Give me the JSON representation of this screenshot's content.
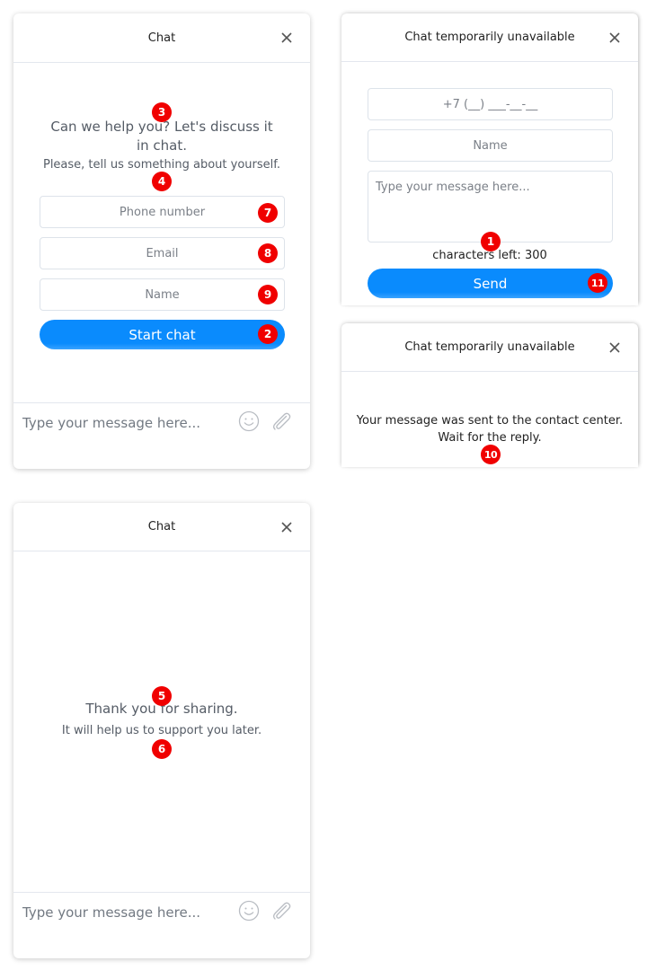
{
  "panel_start": {
    "title": "Chat",
    "heading": "Can we help you? Let's discuss it in chat.",
    "subheading": "Please, tell us something about yourself.",
    "fields": [
      {
        "placeholder": "Phone number",
        "badge": "7"
      },
      {
        "placeholder": "Email",
        "badge": "8"
      },
      {
        "placeholder": "Name",
        "badge": "9"
      }
    ],
    "start_button": "Start chat",
    "start_badge": "2",
    "heading_badge": "3",
    "subheading_badge": "4",
    "message_placeholder": "Type your message here..."
  },
  "panel_offline_form": {
    "title": "Chat temporarily unavailable",
    "phone_mask": "+7 (__) ___-__-__",
    "name_placeholder": "Name",
    "message_placeholder": "Type your message here...",
    "chars_left": "characters left: 300",
    "chars_badge": "1",
    "send_button": "Send",
    "send_badge": "11"
  },
  "panel_offline_sent": {
    "title": "Chat temporarily unavailable",
    "message": "Your message was sent to the contact center. Wait for the reply.",
    "message_badge": "10"
  },
  "panel_thanks": {
    "title": "Chat",
    "heading": "Thank you for sharing.",
    "subheading": "It will help us to support you later.",
    "heading_badge": "5",
    "subheading_badge": "6",
    "message_placeholder": "Type your message here..."
  },
  "icons": {
    "close": "close-icon",
    "emoji": "smiley-icon",
    "attach": "paperclip-icon"
  },
  "colors": {
    "accent": "#0a8bfd",
    "badge": "#f00000"
  }
}
